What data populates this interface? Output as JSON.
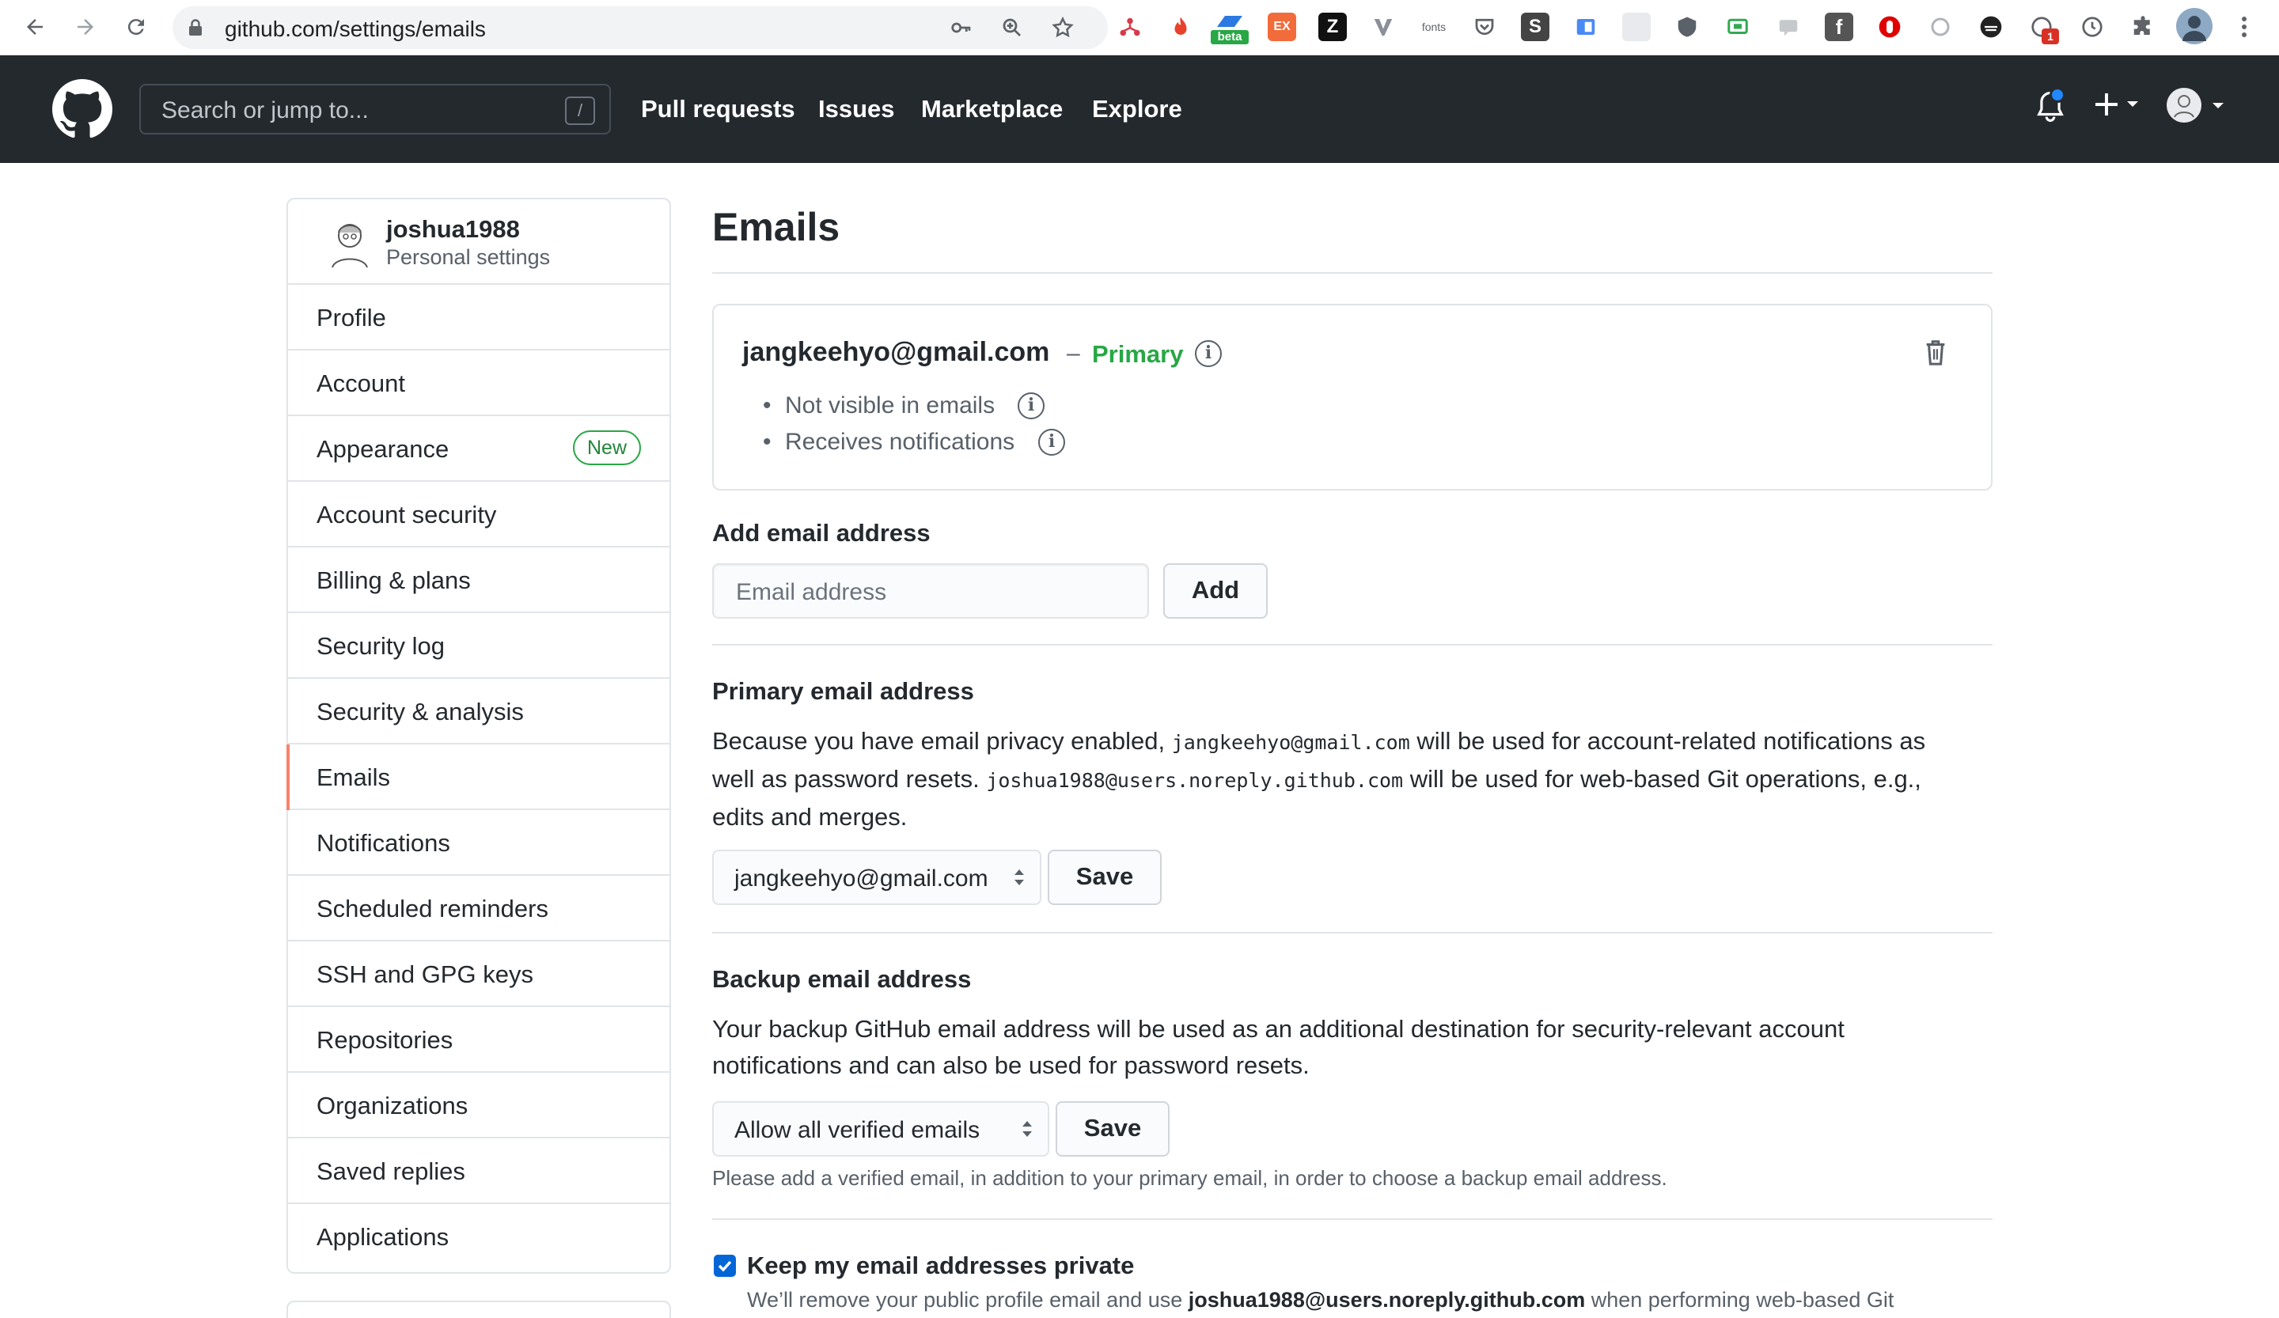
{
  "browser": {
    "url": "github.com/settings/emails",
    "extension_beta_label": "beta",
    "extension_fonts_label": "fonts",
    "extension_ex_label": "EX",
    "extension_z_label": "Z",
    "extension_s_label": "S",
    "extension_f_label": "f",
    "extension_badge_count": "1"
  },
  "header": {
    "search_placeholder": "Search or jump to...",
    "search_shortcut": "/",
    "nav": [
      "Pull requests",
      "Issues",
      "Marketplace",
      "Explore"
    ],
    "plus": "+"
  },
  "sidebar": {
    "username": "joshua1988",
    "subtitle": "Personal settings",
    "items": [
      {
        "label": "Profile"
      },
      {
        "label": "Account"
      },
      {
        "label": "Appearance",
        "badge": "New"
      },
      {
        "label": "Account security"
      },
      {
        "label": "Billing & plans"
      },
      {
        "label": "Security log"
      },
      {
        "label": "Security & analysis"
      },
      {
        "label": "Emails",
        "active": true
      },
      {
        "label": "Notifications"
      },
      {
        "label": "Scheduled reminders"
      },
      {
        "label": "SSH and GPG keys"
      },
      {
        "label": "Repositories"
      },
      {
        "label": "Organizations"
      },
      {
        "label": "Saved replies"
      },
      {
        "label": "Applications"
      }
    ]
  },
  "main": {
    "title": "Emails",
    "email_card": {
      "address": "jangkeehyo@gmail.com",
      "separator": "–",
      "primary_label": "Primary",
      "bullets": [
        "Not visible in emails",
        "Receives notifications"
      ]
    },
    "add_email": {
      "heading": "Add email address",
      "placeholder": "Email address",
      "button": "Add"
    },
    "primary_email": {
      "heading": "Primary email address",
      "text_1": "Because you have email privacy enabled, ",
      "code_1": "jangkeehyo@gmail.com",
      "text_2": " will be used for account-related notifications as",
      "text_3": "well as password resets. ",
      "code_2": "joshua1988@users.noreply.github.com",
      "text_4": " will be used for web-based Git operations, e.g.,",
      "text_5": "edits and merges.",
      "selected": "jangkeehyo@gmail.com",
      "button": "Save"
    },
    "backup_email": {
      "heading": "Backup email address",
      "text_line1": "Your backup GitHub email address will be used as an additional destination for security-relevant account",
      "text_line2": "notifications and can also be used for password resets.",
      "selected": "Allow all verified emails",
      "button": "Save",
      "note": "Please add a verified email, in addition to your primary email, in order to choose a backup email address."
    },
    "private": {
      "checked": true,
      "label": "Keep my email addresses private",
      "desc_1": "We’ll remove your public profile email and use ",
      "desc_email": "joshua1988@users.noreply.github.com",
      "desc_2": " when performing web-based Git"
    }
  },
  "colors": {
    "header_bg": "#24292e",
    "primary_green": "#28a745",
    "active_accent": "#f9826c",
    "checkbox_blue": "#0366d6"
  }
}
